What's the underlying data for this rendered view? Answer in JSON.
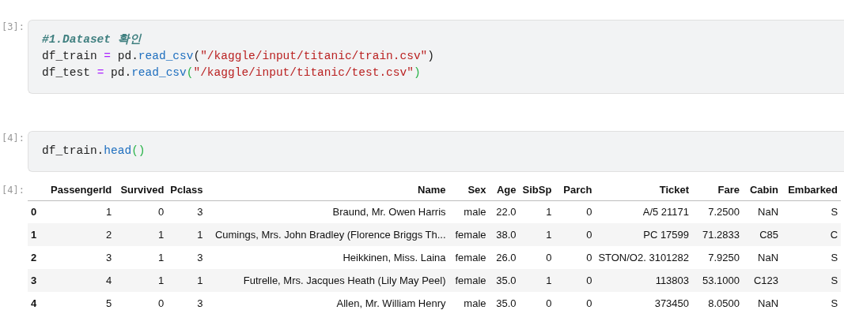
{
  "cells": [
    {
      "prompt": "[3]:",
      "lines": [
        [
          {
            "kind": "comment",
            "text": "#1.Dataset 확인"
          }
        ],
        [
          {
            "kind": "name",
            "text": "df_train "
          },
          {
            "kind": "op",
            "text": "="
          },
          {
            "kind": "name",
            "text": " pd."
          },
          {
            "kind": "func",
            "text": "read_csv"
          },
          {
            "kind": "paren",
            "text": "("
          },
          {
            "kind": "string",
            "text": "\"/kaggle/input/titanic/train.csv\""
          },
          {
            "kind": "paren",
            "text": ")"
          }
        ],
        [
          {
            "kind": "name",
            "text": "df_test "
          },
          {
            "kind": "op",
            "text": "="
          },
          {
            "kind": "name",
            "text": " pd."
          },
          {
            "kind": "func",
            "text": "read_csv"
          },
          {
            "kind": "match",
            "text": "("
          },
          {
            "kind": "string",
            "text": "\"/kaggle/input/titanic/test.csv\""
          },
          {
            "kind": "match",
            "text": ")"
          }
        ]
      ]
    },
    {
      "prompt": "[4]:",
      "lines": [
        [
          {
            "kind": "name",
            "text": "df_train."
          },
          {
            "kind": "func",
            "text": "head"
          },
          {
            "kind": "match",
            "text": "()"
          }
        ]
      ],
      "output": {
        "prompt": "[4]:",
        "table": {
          "columns": [
            "",
            "PassengerId",
            "Survived",
            "Pclass",
            "Name",
            "Sex",
            "Age",
            "SibSp",
            "Parch",
            "Ticket",
            "Fare",
            "Cabin",
            "Embarked"
          ],
          "rows": [
            [
              "0",
              "1",
              "0",
              "3",
              "Braund, Mr. Owen Harris",
              "male",
              "22.0",
              "1",
              "0",
              "A/5 21171",
              "7.2500",
              "NaN",
              "S"
            ],
            [
              "1",
              "2",
              "1",
              "1",
              "Cumings, Mrs. John Bradley (Florence Briggs Th...",
              "female",
              "38.0",
              "1",
              "0",
              "PC 17599",
              "71.2833",
              "C85",
              "C"
            ],
            [
              "2",
              "3",
              "1",
              "3",
              "Heikkinen, Miss. Laina",
              "female",
              "26.0",
              "0",
              "0",
              "STON/O2. 3101282",
              "7.9250",
              "NaN",
              "S"
            ],
            [
              "3",
              "4",
              "1",
              "1",
              "Futrelle, Mrs. Jacques Heath (Lily May Peel)",
              "female",
              "35.0",
              "1",
              "0",
              "113803",
              "53.1000",
              "C123",
              "S"
            ],
            [
              "4",
              "5",
              "0",
              "3",
              "Allen, Mr. William Henry",
              "male",
              "35.0",
              "0",
              "0",
              "373450",
              "8.0500",
              "NaN",
              "S"
            ]
          ]
        }
      }
    }
  ]
}
